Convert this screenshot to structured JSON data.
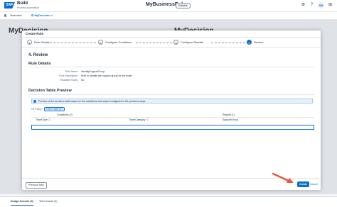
{
  "shell": {
    "logo": "SAP",
    "product": "Build",
    "subtitle": "Process Automation",
    "center_title": "MyBusinessRule",
    "badge": "Editable",
    "avatar": "SM"
  },
  "tabs": {
    "overview": "Overview",
    "mydecision": "MyDecision"
  },
  "background": {
    "title_left": "MyDecision",
    "title_right": "MyDecision"
  },
  "dialog": {
    "title": "Create Rule",
    "steps": [
      {
        "num": "1",
        "label": "Rule Details"
      },
      {
        "num": "2",
        "label": "Configure Conditions"
      },
      {
        "num": "3",
        "label": "Configure Results"
      },
      {
        "num": "4",
        "label": "Review"
      }
    ],
    "review_heading": "4. Review",
    "rule_details_heading": "Rule Details",
    "rule_name_label": "Rule Name:",
    "rule_name_value": "IdentifySupportGroup",
    "rule_desc_label": "Rule Description:",
    "rule_desc_value": "Rule to identify the support group for the ticket",
    "reusable_label": "Reusable Rules:",
    "reusable_value": "No",
    "preview_heading": "Decision Table Preview",
    "info_text": "Preview of the decision table based on the conditions and output configured in the previous steps",
    "hit_policy_label": "Hit Policy:",
    "hit_policy_value": "FIRST MATCH",
    "conditions_label": "Conditions (2)",
    "results_label": "Results (1)",
    "col_ticket_type": "TicketType",
    "col_ticket_category": "TicketCategory",
    "col_support_group": "SupportGroup",
    "previous_step": "Previous Step",
    "create": "Create",
    "cancel": "Cancel"
  },
  "console": {
    "design": "Design Console (0)",
    "test": "Test Console (0)"
  },
  "colors": {
    "accent": "#0a6ed1",
    "arrow": "#e9573f"
  }
}
